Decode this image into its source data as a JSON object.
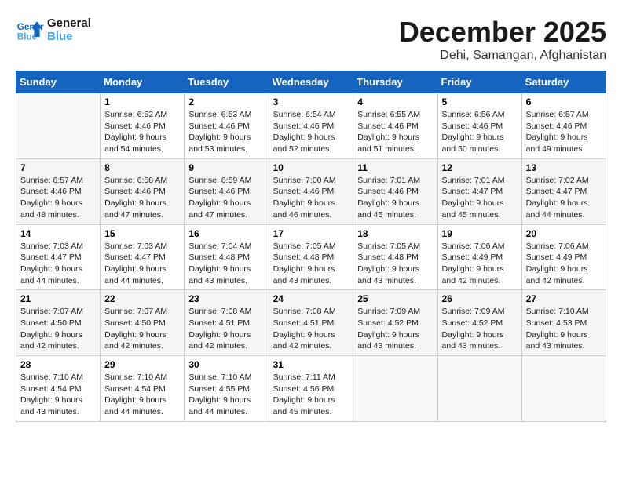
{
  "logo": {
    "line1": "General",
    "line2": "Blue"
  },
  "title": "December 2025",
  "location": "Dehi, Samangan, Afghanistan",
  "weekdays": [
    "Sunday",
    "Monday",
    "Tuesday",
    "Wednesday",
    "Thursday",
    "Friday",
    "Saturday"
  ],
  "weeks": [
    [
      {
        "day": "",
        "info": ""
      },
      {
        "day": "1",
        "info": "Sunrise: 6:52 AM\nSunset: 4:46 PM\nDaylight: 9 hours\nand 54 minutes."
      },
      {
        "day": "2",
        "info": "Sunrise: 6:53 AM\nSunset: 4:46 PM\nDaylight: 9 hours\nand 53 minutes."
      },
      {
        "day": "3",
        "info": "Sunrise: 6:54 AM\nSunset: 4:46 PM\nDaylight: 9 hours\nand 52 minutes."
      },
      {
        "day": "4",
        "info": "Sunrise: 6:55 AM\nSunset: 4:46 PM\nDaylight: 9 hours\nand 51 minutes."
      },
      {
        "day": "5",
        "info": "Sunrise: 6:56 AM\nSunset: 4:46 PM\nDaylight: 9 hours\nand 50 minutes."
      },
      {
        "day": "6",
        "info": "Sunrise: 6:57 AM\nSunset: 4:46 PM\nDaylight: 9 hours\nand 49 minutes."
      }
    ],
    [
      {
        "day": "7",
        "info": "Sunrise: 6:57 AM\nSunset: 4:46 PM\nDaylight: 9 hours\nand 48 minutes."
      },
      {
        "day": "8",
        "info": "Sunrise: 6:58 AM\nSunset: 4:46 PM\nDaylight: 9 hours\nand 47 minutes."
      },
      {
        "day": "9",
        "info": "Sunrise: 6:59 AM\nSunset: 4:46 PM\nDaylight: 9 hours\nand 47 minutes."
      },
      {
        "day": "10",
        "info": "Sunrise: 7:00 AM\nSunset: 4:46 PM\nDaylight: 9 hours\nand 46 minutes."
      },
      {
        "day": "11",
        "info": "Sunrise: 7:01 AM\nSunset: 4:46 PM\nDaylight: 9 hours\nand 45 minutes."
      },
      {
        "day": "12",
        "info": "Sunrise: 7:01 AM\nSunset: 4:47 PM\nDaylight: 9 hours\nand 45 minutes."
      },
      {
        "day": "13",
        "info": "Sunrise: 7:02 AM\nSunset: 4:47 PM\nDaylight: 9 hours\nand 44 minutes."
      }
    ],
    [
      {
        "day": "14",
        "info": "Sunrise: 7:03 AM\nSunset: 4:47 PM\nDaylight: 9 hours\nand 44 minutes."
      },
      {
        "day": "15",
        "info": "Sunrise: 7:03 AM\nSunset: 4:47 PM\nDaylight: 9 hours\nand 44 minutes."
      },
      {
        "day": "16",
        "info": "Sunrise: 7:04 AM\nSunset: 4:48 PM\nDaylight: 9 hours\nand 43 minutes."
      },
      {
        "day": "17",
        "info": "Sunrise: 7:05 AM\nSunset: 4:48 PM\nDaylight: 9 hours\nand 43 minutes."
      },
      {
        "day": "18",
        "info": "Sunrise: 7:05 AM\nSunset: 4:48 PM\nDaylight: 9 hours\nand 43 minutes."
      },
      {
        "day": "19",
        "info": "Sunrise: 7:06 AM\nSunset: 4:49 PM\nDaylight: 9 hours\nand 42 minutes."
      },
      {
        "day": "20",
        "info": "Sunrise: 7:06 AM\nSunset: 4:49 PM\nDaylight: 9 hours\nand 42 minutes."
      }
    ],
    [
      {
        "day": "21",
        "info": "Sunrise: 7:07 AM\nSunset: 4:50 PM\nDaylight: 9 hours\nand 42 minutes."
      },
      {
        "day": "22",
        "info": "Sunrise: 7:07 AM\nSunset: 4:50 PM\nDaylight: 9 hours\nand 42 minutes."
      },
      {
        "day": "23",
        "info": "Sunrise: 7:08 AM\nSunset: 4:51 PM\nDaylight: 9 hours\nand 42 minutes."
      },
      {
        "day": "24",
        "info": "Sunrise: 7:08 AM\nSunset: 4:51 PM\nDaylight: 9 hours\nand 42 minutes."
      },
      {
        "day": "25",
        "info": "Sunrise: 7:09 AM\nSunset: 4:52 PM\nDaylight: 9 hours\nand 43 minutes."
      },
      {
        "day": "26",
        "info": "Sunrise: 7:09 AM\nSunset: 4:52 PM\nDaylight: 9 hours\nand 43 minutes."
      },
      {
        "day": "27",
        "info": "Sunrise: 7:10 AM\nSunset: 4:53 PM\nDaylight: 9 hours\nand 43 minutes."
      }
    ],
    [
      {
        "day": "28",
        "info": "Sunrise: 7:10 AM\nSunset: 4:54 PM\nDaylight: 9 hours\nand 43 minutes."
      },
      {
        "day": "29",
        "info": "Sunrise: 7:10 AM\nSunset: 4:54 PM\nDaylight: 9 hours\nand 44 minutes."
      },
      {
        "day": "30",
        "info": "Sunrise: 7:10 AM\nSunset: 4:55 PM\nDaylight: 9 hours\nand 44 minutes."
      },
      {
        "day": "31",
        "info": "Sunrise: 7:11 AM\nSunset: 4:56 PM\nDaylight: 9 hours\nand 45 minutes."
      },
      {
        "day": "",
        "info": ""
      },
      {
        "day": "",
        "info": ""
      },
      {
        "day": "",
        "info": ""
      }
    ]
  ]
}
